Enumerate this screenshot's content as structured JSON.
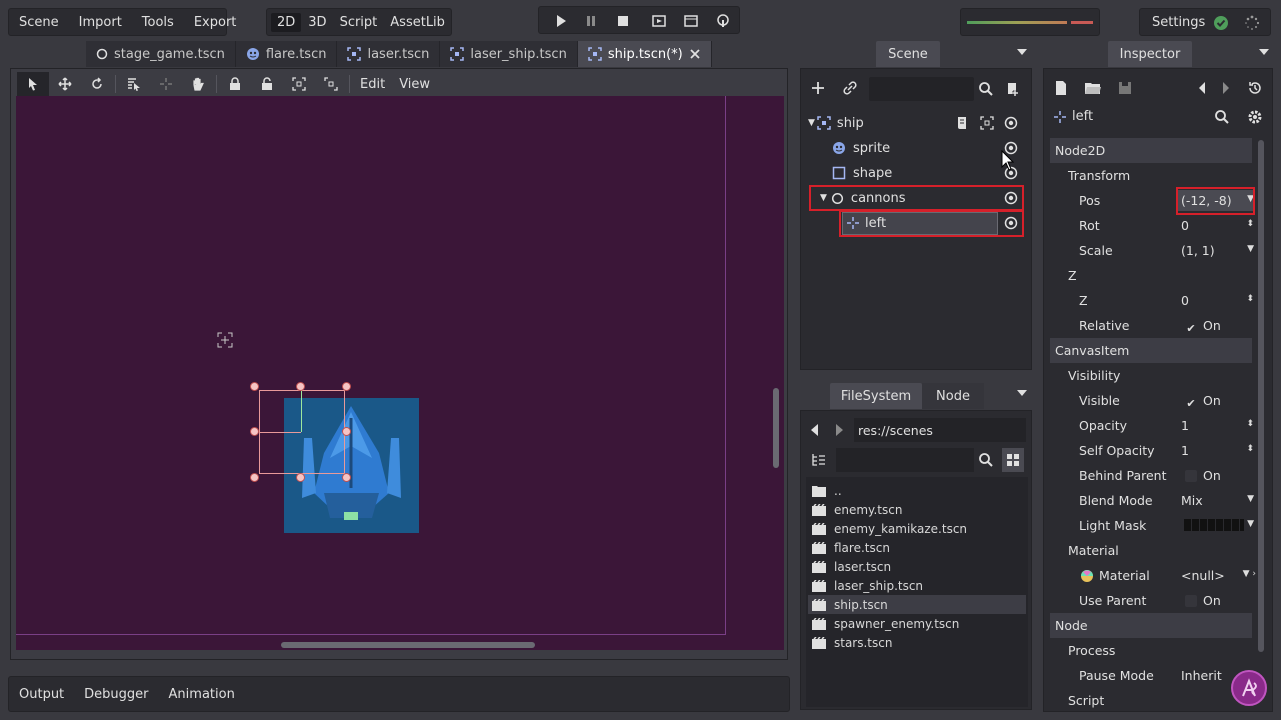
{
  "menu": {
    "scene": "Scene",
    "import": "Import",
    "tools": "Tools",
    "export": "Export"
  },
  "modes": {
    "d2": "2D",
    "d3": "3D",
    "script": "Script",
    "assetlib": "AssetLib"
  },
  "settings_label": "Settings",
  "tabs": [
    {
      "label": "stage_game.tscn",
      "icon": "node-circle-icon"
    },
    {
      "label": "flare.tscn",
      "icon": "sprite-icon"
    },
    {
      "label": "laser.tscn",
      "icon": "node2d-bracket-icon"
    },
    {
      "label": "laser_ship.tscn",
      "icon": "node2d-bracket-icon"
    },
    {
      "label": "ship.tscn(*)",
      "icon": "node2d-bracket-icon"
    }
  ],
  "viewport_menu": {
    "edit": "Edit",
    "view": "View"
  },
  "bottom_tabs": {
    "output": "Output",
    "debugger": "Debugger",
    "animation": "Animation"
  },
  "scene_panel": {
    "title": "Scene",
    "nodes": [
      {
        "label": "ship",
        "icon": "node2d-bracket-icon"
      },
      {
        "label": "sprite",
        "icon": "sprite-icon"
      },
      {
        "label": "shape",
        "icon": "collision-shape-icon"
      },
      {
        "label": "cannons",
        "icon": "node-circle-icon"
      },
      {
        "label": "left",
        "icon": "position2d-icon"
      }
    ]
  },
  "filesystem": {
    "tab_filesystem": "FileSystem",
    "tab_node": "Node",
    "path": "res://scenes",
    "files": [
      "..",
      "enemy.tscn",
      "enemy_kamikaze.tscn",
      "flare.tscn",
      "laser.tscn",
      "laser_ship.tscn",
      "ship.tscn",
      "spawner_enemy.tscn",
      "stars.tscn"
    ],
    "selected": "ship.tscn"
  },
  "inspector": {
    "title": "Inspector",
    "node_name": "left",
    "sec_node2d": "Node2D",
    "grp_transform": "Transform",
    "pos_label": "Pos",
    "pos_value": "(-12, -8)",
    "rot_label": "Rot",
    "rot_value": "0",
    "scale_label": "Scale",
    "scale_value": "(1, 1)",
    "grp_z": "Z",
    "z_label": "Z",
    "z_value": "0",
    "relative_label": "Relative",
    "relative_value": "On",
    "sec_canvasitem": "CanvasItem",
    "grp_visibility": "Visibility",
    "visible_label": "Visible",
    "visible_value": "On",
    "opacity_label": "Opacity",
    "opacity_value": "1",
    "selfopacity_label": "Self Opacity",
    "selfopacity_value": "1",
    "behind_label": "Behind Parent",
    "behind_value": "On",
    "blend_label": "Blend Mode",
    "blend_value": "Mix",
    "lightmask_label": "Light Mask",
    "grp_material": "Material",
    "material_label": "Material",
    "material_value": "<null>",
    "useparent_label": "Use Parent",
    "useparent_value": "On",
    "sec_node": "Node",
    "grp_process": "Process",
    "pause_label": "Pause Mode",
    "pause_value": "Inherit",
    "script_label": "Script"
  },
  "colors": {
    "canvas": "#3b1638",
    "highlight": "#d6202a",
    "ship_blue": "#2f7bd1"
  }
}
